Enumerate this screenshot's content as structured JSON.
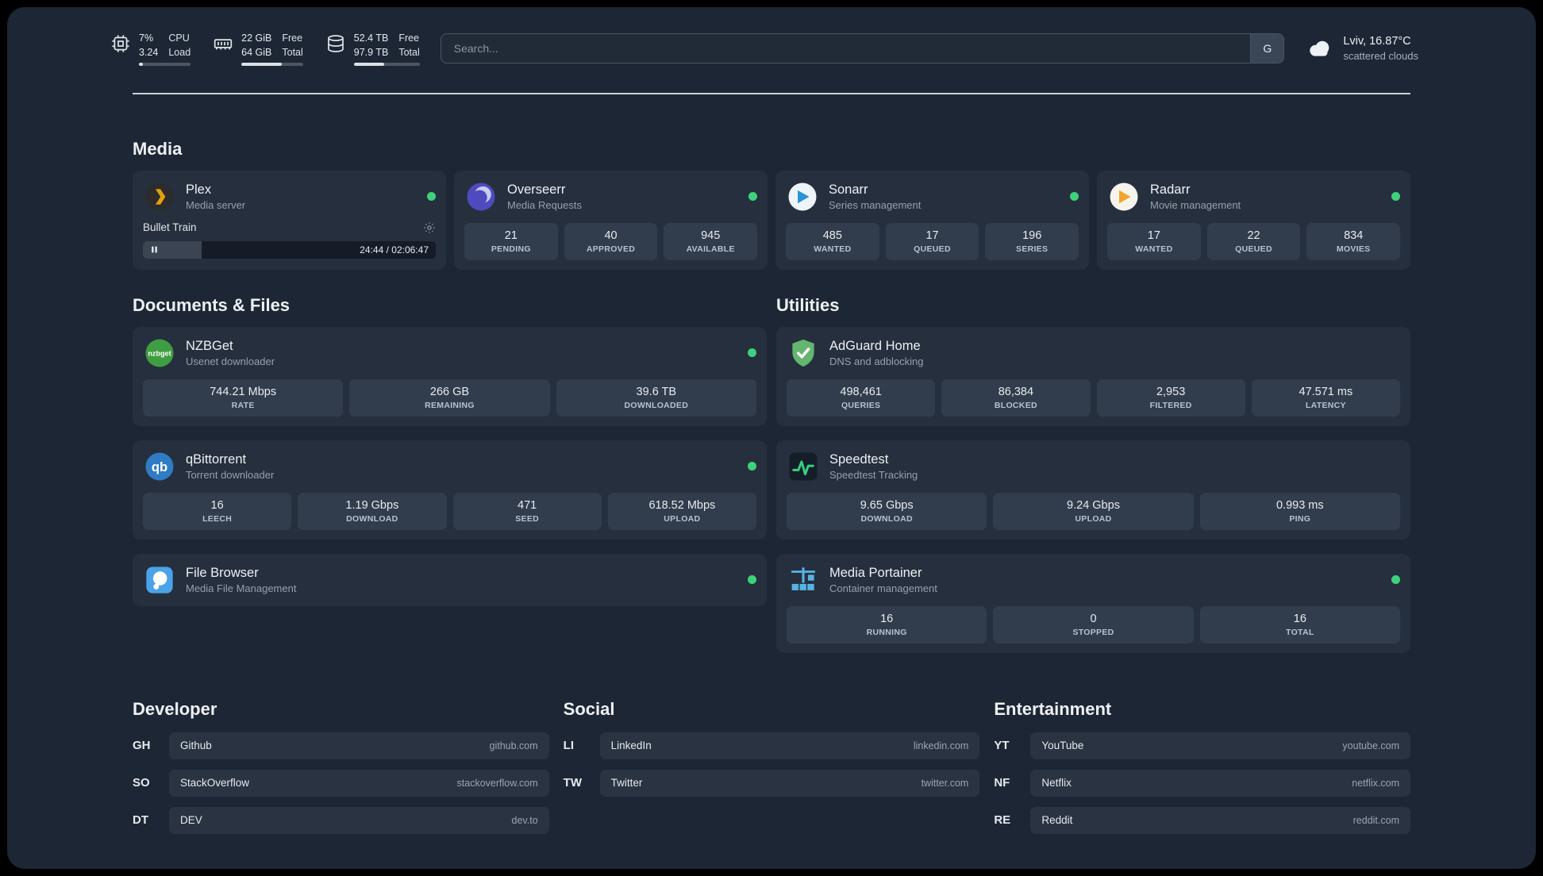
{
  "topbar": {
    "cpu": {
      "icon": "cpu-chip-icon",
      "value_top": "7%",
      "value_bottom": "3.24",
      "label_top": "CPU",
      "label_bottom": "Load",
      "progress_percent": 7
    },
    "memory": {
      "icon": "memory-icon",
      "value_top": "22 GiB",
      "value_bottom": "64 GiB",
      "label_top": "Free",
      "label_bottom": "Total",
      "progress_percent": 66
    },
    "disk": {
      "icon": "disk-icon",
      "value_top": "52.4 TB",
      "value_bottom": "97.9 TB",
      "label_top": "Free",
      "label_bottom": "Total",
      "progress_percent": 46
    },
    "search": {
      "placeholder": "Search...",
      "provider_button": "G"
    },
    "weather": {
      "icon": "cloud-icon",
      "location": "Lviv, 16.87°C",
      "condition": "scattered clouds"
    }
  },
  "sections": {
    "media": {
      "title": "Media",
      "cards": [
        {
          "name": "Plex",
          "subtitle": "Media server",
          "icon": "plex-icon",
          "online": true,
          "now_playing": {
            "title": "Bullet Train",
            "state": "paused",
            "time": "24:44 / 02:06:47",
            "progress_percent": 20
          }
        },
        {
          "name": "Overseerr",
          "subtitle": "Media Requests",
          "icon": "overseerr-icon",
          "online": true,
          "stats": [
            {
              "value": "21",
              "label": "PENDING"
            },
            {
              "value": "40",
              "label": "APPROVED"
            },
            {
              "value": "945",
              "label": "AVAILABLE"
            }
          ]
        },
        {
          "name": "Sonarr",
          "subtitle": "Series management",
          "icon": "sonarr-icon",
          "online": true,
          "stats": [
            {
              "value": "485",
              "label": "WANTED"
            },
            {
              "value": "17",
              "label": "QUEUED"
            },
            {
              "value": "196",
              "label": "SERIES"
            }
          ]
        },
        {
          "name": "Radarr",
          "subtitle": "Movie management",
          "icon": "radarr-icon",
          "online": true,
          "stats": [
            {
              "value": "17",
              "label": "WANTED"
            },
            {
              "value": "22",
              "label": "QUEUED"
            },
            {
              "value": "834",
              "label": "MOVIES"
            }
          ]
        }
      ]
    },
    "documents": {
      "title": "Documents & Files",
      "cards": [
        {
          "name": "NZBGet",
          "subtitle": "Usenet downloader",
          "icon": "nzbget-icon",
          "online": true,
          "stats": [
            {
              "value": "744.21 Mbps",
              "label": "RATE"
            },
            {
              "value": "266 GB",
              "label": "REMAINING"
            },
            {
              "value": "39.6 TB",
              "label": "DOWNLOADED"
            }
          ]
        },
        {
          "name": "qBittorrent",
          "subtitle": "Torrent downloader",
          "icon": "qbittorrent-icon",
          "online": true,
          "stats": [
            {
              "value": "16",
              "label": "LEECH"
            },
            {
              "value": "1.19 Gbps",
              "label": "DOWNLOAD"
            },
            {
              "value": "471",
              "label": "SEED"
            },
            {
              "value": "618.52 Mbps",
              "label": "UPLOAD"
            }
          ]
        },
        {
          "name": "File Browser",
          "subtitle": "Media File Management",
          "icon": "filebrowser-icon",
          "online": true,
          "stats": []
        }
      ]
    },
    "utilities": {
      "title": "Utilities",
      "cards": [
        {
          "name": "AdGuard Home",
          "subtitle": "DNS and adblocking",
          "icon": "adguard-shield-icon",
          "online": false,
          "stats": [
            {
              "value": "498,461",
              "label": "QUERIES"
            },
            {
              "value": "86,384",
              "label": "BLOCKED"
            },
            {
              "value": "2,953",
              "label": "FILTERED"
            },
            {
              "value": "47.571 ms",
              "label": "LATENCY"
            }
          ]
        },
        {
          "name": "Speedtest",
          "subtitle": "Speedtest Tracking",
          "icon": "speedtest-graph-icon",
          "online": false,
          "stats": [
            {
              "value": "9.65 Gbps",
              "label": "DOWNLOAD"
            },
            {
              "value": "9.24 Gbps",
              "label": "UPLOAD"
            },
            {
              "value": "0.993 ms",
              "label": "PING"
            }
          ]
        },
        {
          "name": "Media Portainer",
          "subtitle": "Container management",
          "icon": "portainer-crane-icon",
          "online": true,
          "stats": [
            {
              "value": "16",
              "label": "RUNNING"
            },
            {
              "value": "0",
              "label": "STOPPED"
            },
            {
              "value": "16",
              "label": "TOTAL"
            }
          ]
        }
      ]
    }
  },
  "bookmarks": {
    "groups": [
      {
        "title": "Developer",
        "links": [
          {
            "abbr": "GH",
            "name": "Github",
            "domain": "github.com"
          },
          {
            "abbr": "SO",
            "name": "StackOverflow",
            "domain": "stackoverflow.com"
          },
          {
            "abbr": "DT",
            "name": "DEV",
            "domain": "dev.to"
          }
        ]
      },
      {
        "title": "Social",
        "links": [
          {
            "abbr": "LI",
            "name": "LinkedIn",
            "domain": "linkedin.com"
          },
          {
            "abbr": "TW",
            "name": "Twitter",
            "domain": "twitter.com"
          }
        ]
      },
      {
        "title": "Entertainment",
        "links": [
          {
            "abbr": "YT",
            "name": "YouTube",
            "domain": "youtube.com"
          },
          {
            "abbr": "NF",
            "name": "Netflix",
            "domain": "netflix.com"
          },
          {
            "abbr": "RE",
            "name": "Reddit",
            "domain": "reddit.com"
          }
        ]
      }
    ]
  },
  "colors": {
    "status_online": "#3ed17c",
    "background": "#1d2634",
    "card": "#262f3d",
    "tile": "#313c4d",
    "plex_accent": "#e5a00d"
  }
}
